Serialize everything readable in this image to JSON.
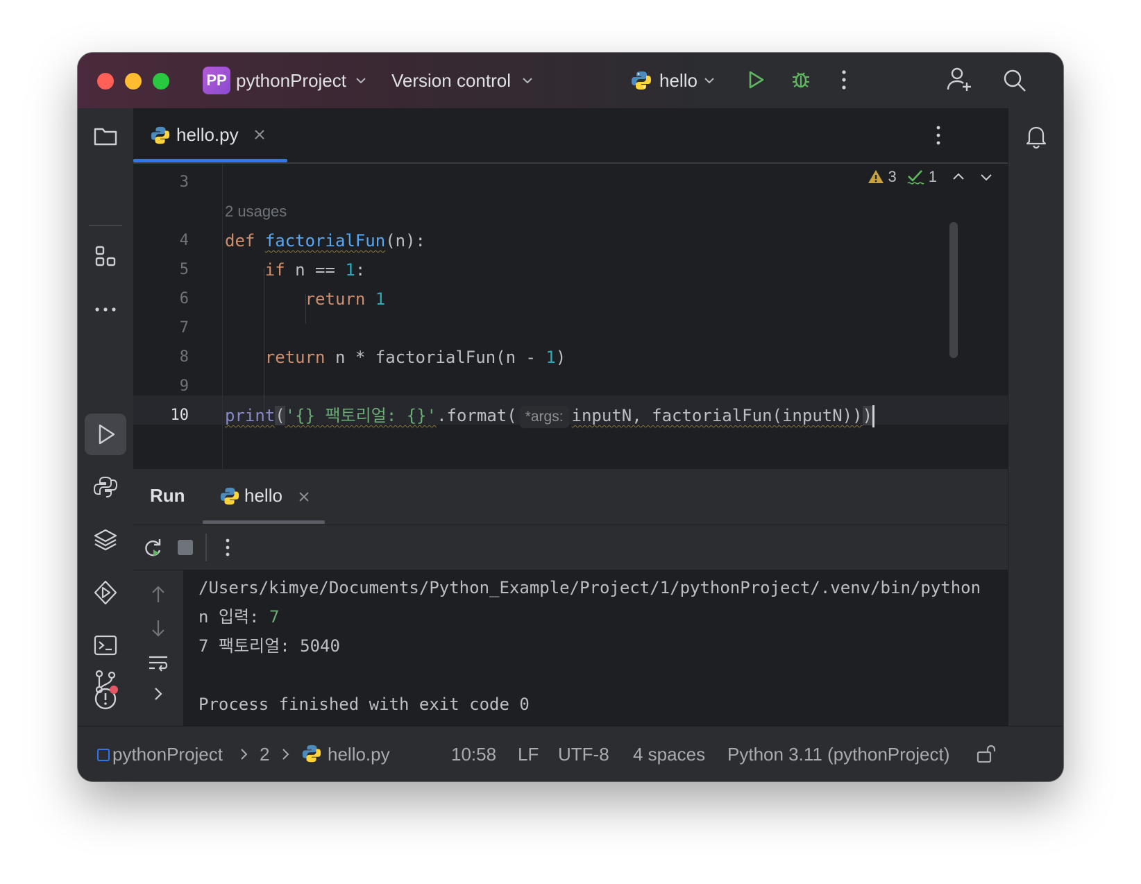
{
  "titlebar": {
    "project_badge": "PP",
    "project_name": "pythonProject",
    "vcs": "Version control",
    "run_config": "hello"
  },
  "editor": {
    "tab": {
      "filename": "hello.py"
    },
    "inspections": {
      "warnings": "3",
      "weak_warnings": "1"
    },
    "usages_hint": "2 usages",
    "line_numbers": [
      "3",
      "4",
      "5",
      "6",
      "7",
      "8",
      "9",
      "10"
    ],
    "code": {
      "l4_def": "def",
      "l4_fn": "factorialFun",
      "l4_rest": "(n):",
      "l5_if": "if",
      "l5_mid": " n == ",
      "l5_num": "1",
      "l5_end": ":",
      "l6_return": "return",
      "l6_num": "1",
      "l8_return": "return",
      "l8_mid": " n * factorialFun(n - ",
      "l8_num": "1",
      "l8_end": ")",
      "l10_print": "print",
      "l10_open": "(",
      "l10_str": "'{} 팩토리얼: {}'",
      "l10_format": ".format(",
      "l10_hint": "*args:",
      "l10_args": "inputN, factorialFun(inputN))",
      "l10_close": ")"
    }
  },
  "run": {
    "title": "Run",
    "tab": "hello",
    "console": [
      "/Users/kimye/Documents/Python_Example/Project/1/pythonProject/.venv/bin/python",
      "",
      "7 팩토리얼: 5040",
      "",
      "Process finished with exit code 0"
    ],
    "input_prompt": "n 입력: ",
    "input_value": "7"
  },
  "statusbar": {
    "breadcrumb": [
      "pythonProject",
      "2",
      "hello.py"
    ],
    "position": "10:58",
    "line_ending": "LF",
    "encoding": "UTF-8",
    "indent": "4 spaces",
    "interpreter": "Python 3.11 (pythonProject)"
  }
}
